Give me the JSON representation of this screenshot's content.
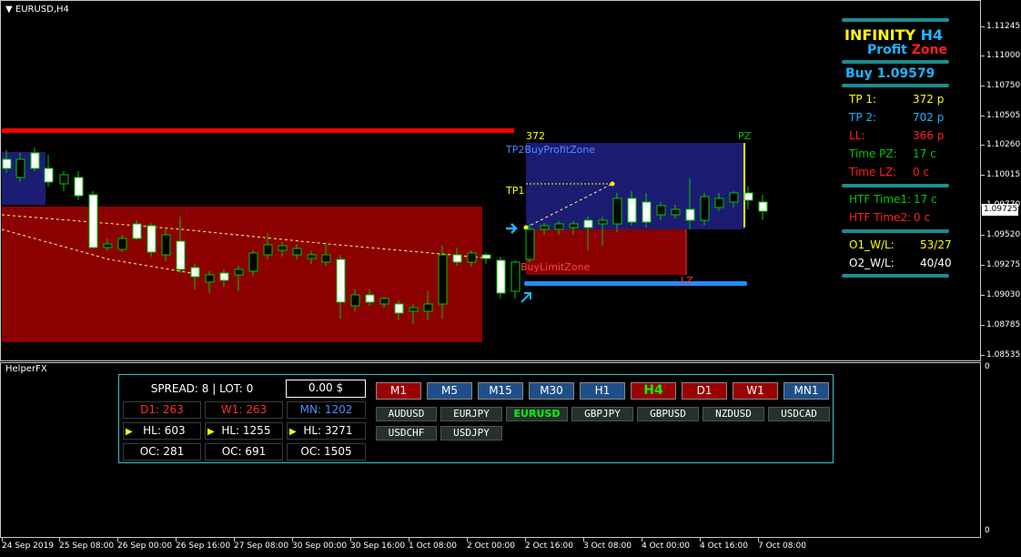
{
  "chart": {
    "symbol_label": "EURUSD,H4",
    "price_axis": [
      "1.11245",
      "1.11000",
      "1.10750",
      "1.10505",
      "1.10260",
      "1.10015",
      "1.09770",
      "1.09520",
      "1.09275",
      "1.09030",
      "1.08785",
      "1.08535"
    ],
    "current_price": "1.09725",
    "time_axis": [
      "24 Sep 2019",
      "25 Sep 08:00",
      "26 Sep 00:00",
      "26 Sep 16:00",
      "27 Sep 08:00",
      "30 Sep 00:00",
      "30 Sep 16:00",
      "1 Oct 08:00",
      "2 Oct 00:00",
      "2 Oct 16:00",
      "3 Oct 08:00",
      "4 Oct 00:00",
      "4 Oct 16:00",
      "7 Oct 08:00"
    ],
    "labels": {
      "pips_372": "372",
      "tp2_zone": "TP2BuyProfitZone",
      "tp1": "TP1",
      "pz": "PZ",
      "buy_limit_zone": "BuyLimitZone",
      "lz": "LZ"
    }
  },
  "info_panel": {
    "title_infinity": "INFINITY",
    "title_tf": "H4",
    "subtitle_profit": "Profit",
    "subtitle_zone": "Zone",
    "signal": "Buy 1.09579",
    "rows": [
      {
        "label": "TP 1:",
        "value": "372 p"
      },
      {
        "label": "TP 2:",
        "value": "702 p"
      },
      {
        "label": "LL:",
        "value": "366 p"
      },
      {
        "label": "Time PZ:",
        "value": "17 c"
      },
      {
        "label": "Time LZ:",
        "value": "0 c"
      }
    ],
    "htf": [
      {
        "label": "HTF Time1:",
        "value": "17 c"
      },
      {
        "label": "HTF Time2:",
        "value": "0 c"
      }
    ],
    "stats": [
      {
        "label": "O1_W/L:",
        "value": "53/27"
      },
      {
        "label": "O2_W/L:",
        "value": "40/40"
      }
    ]
  },
  "subwindow": {
    "label": "HelperFX",
    "scale_top": "0",
    "scale_bottom": "0"
  },
  "helper": {
    "spread_lot": "SPREAD: 8  |  LOT: 0",
    "profit": "0.00 $",
    "d1": "D1: 263",
    "w1": "W1: 263",
    "mn": "MN: 1202",
    "hl_d": "HL: 603",
    "hl_w": "HL: 1255",
    "hl_m": "HL: 3271",
    "oc_d": "OC: 281",
    "oc_w": "OC: 691",
    "oc_m": "OC: 1505",
    "timeframes": [
      "M1",
      "M5",
      "M15",
      "M30",
      "H1",
      "H4",
      "D1",
      "W1",
      "MN1"
    ],
    "symbols": [
      "AUDUSD",
      "EURJPY",
      "EURUSD",
      "GBPJPY",
      "GBPUSD",
      "NZDUSD",
      "USDCAD",
      "USDCHF",
      "USDJPY"
    ]
  },
  "colors": {
    "bull_candle": "#ffffff",
    "bear_candle": "#000000",
    "wick": "#00c800",
    "profit_zone": "#1c1c73",
    "loss_zone": "#8b0000",
    "red_line": "#ff0000",
    "blue_line": "#1e90ff",
    "teal": "#1e8c8c"
  }
}
